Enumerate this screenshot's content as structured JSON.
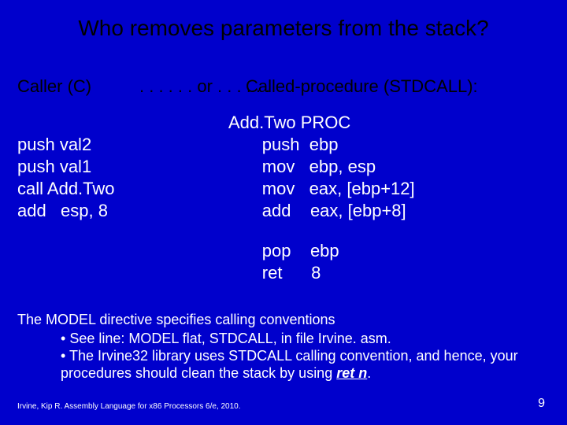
{
  "title": "Who removes parameters from the stack?",
  "labels": {
    "caller": "Caller (C)",
    "or": ". . . . . . or . . . . . .",
    "called": "Called-procedure (STDCALL):"
  },
  "caller_code": "push val2\npush val1\ncall Add.Two\nadd   esp, 8",
  "callee_code_top": "Add.Two PROC\n       push  ebp\n       mov   ebp, esp\n       mov   eax, [ebp+12]\n       add    eax, [ebp+8]",
  "callee_code_bot": "       pop    ebp\n       ret      8",
  "notes": {
    "intro": "The MODEL directive specifies calling conventions",
    "b1": "See line: MODEL flat, STDCALL, in file Irvine. asm.",
    "b2_pre": "The Irvine32 library uses STDCALL calling convention, and hence, your procedures should clean the stack by using ",
    "b2_ret": "ret n",
    "b2_post": "."
  },
  "citation": "Irvine, Kip R. Assembly Language for x86 Processors 6/e, 2010.",
  "page": "9"
}
